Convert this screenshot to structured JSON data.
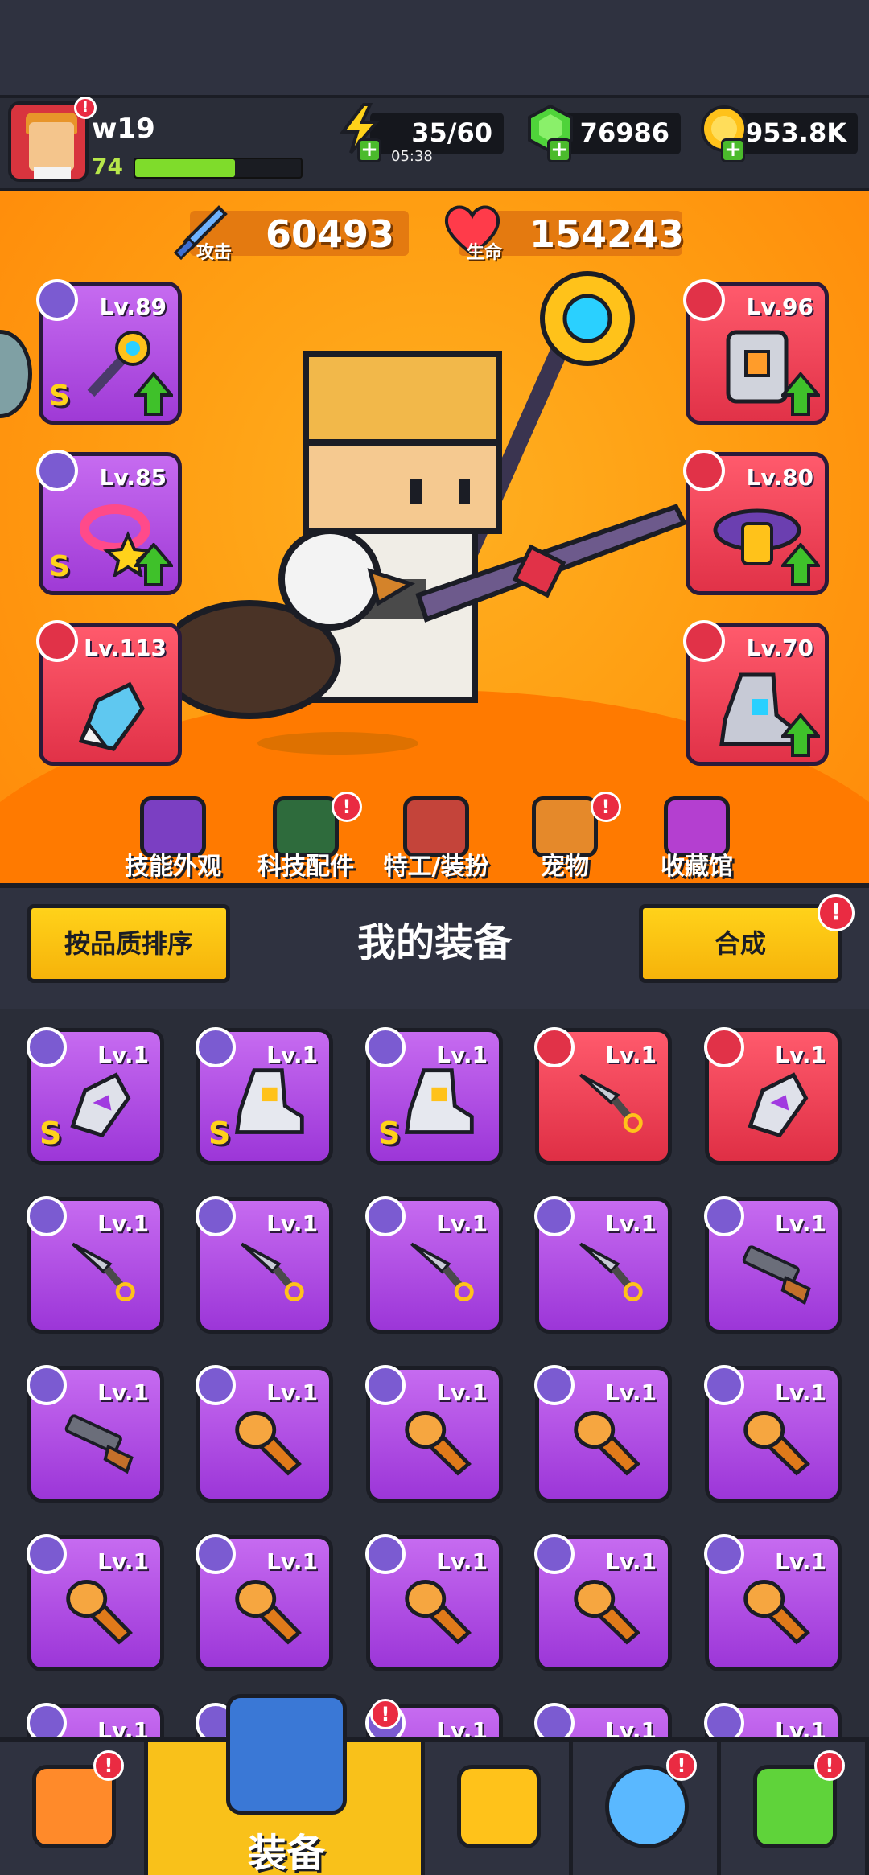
{
  "player": {
    "name": "w19",
    "level": "74",
    "xp_fraction": 0.6
  },
  "resources": {
    "energy": {
      "value": "35/60",
      "timer": "05:38"
    },
    "gems": {
      "value": "76986"
    },
    "gold": {
      "value": "953.8K"
    }
  },
  "stats": {
    "attack": {
      "label": "攻击",
      "value": "60493"
    },
    "hp": {
      "label": "生命",
      "value": "154243"
    }
  },
  "equipped": {
    "weapon": {
      "level": "Lv.89",
      "grade": "S",
      "upgradable": true,
      "icon": "staff-icon"
    },
    "armor": {
      "level": "Lv.96",
      "upgradable": true,
      "icon": "armor-icon"
    },
    "necklace": {
      "level": "Lv.85",
      "grade": "S",
      "upgradable": true,
      "icon": "ring-icon"
    },
    "belt": {
      "level": "Lv.80",
      "upgradable": true,
      "icon": "belt-icon"
    },
    "gloves": {
      "level": "Lv.113",
      "upgradable": false,
      "icon": "glove-icon"
    },
    "boots": {
      "level": "Lv.70",
      "upgradable": true,
      "icon": "boot-icon"
    }
  },
  "tabs": [
    {
      "label": "技能外观",
      "alert": false
    },
    {
      "label": "科技配件",
      "alert": true
    },
    {
      "label": "特工/装扮",
      "alert": false
    },
    {
      "label": "宠物",
      "alert": true
    },
    {
      "label": "收藏馆",
      "alert": false
    }
  ],
  "equipment_panel": {
    "sort_label": "按品质排序",
    "title": "我的装备",
    "merge_label": "合成",
    "badge": "!"
  },
  "inventory": [
    {
      "level": "Lv.1",
      "rarity": "purple",
      "grade": "S",
      "item": "glove-icon"
    },
    {
      "level": "Lv.1",
      "rarity": "purple",
      "grade": "S",
      "item": "boot-icon"
    },
    {
      "level": "Lv.1",
      "rarity": "purple",
      "grade": "S",
      "item": "boot-icon"
    },
    {
      "level": "Lv.1",
      "rarity": "red",
      "grade": "",
      "item": "kunai-icon"
    },
    {
      "level": "Lv.1",
      "rarity": "red",
      "grade": "",
      "item": "glove-icon"
    },
    {
      "level": "Lv.1",
      "rarity": "purple",
      "grade": "",
      "item": "kunai-icon"
    },
    {
      "level": "Lv.1",
      "rarity": "purple",
      "grade": "",
      "item": "kunai-icon"
    },
    {
      "level": "Lv.1",
      "rarity": "purple",
      "grade": "",
      "item": "kunai-icon"
    },
    {
      "level": "Lv.1",
      "rarity": "purple",
      "grade": "",
      "item": "kunai-icon"
    },
    {
      "level": "Lv.1",
      "rarity": "purple",
      "grade": "",
      "item": "shotgun-icon"
    },
    {
      "level": "Lv.1",
      "rarity": "purple",
      "grade": "",
      "item": "shotgun-icon"
    },
    {
      "level": "Lv.1",
      "rarity": "purple",
      "grade": "",
      "item": "rocket-icon"
    },
    {
      "level": "Lv.1",
      "rarity": "purple",
      "grade": "",
      "item": "rocket-icon"
    },
    {
      "level": "Lv.1",
      "rarity": "purple",
      "grade": "",
      "item": "rocket-icon"
    },
    {
      "level": "Lv.1",
      "rarity": "purple",
      "grade": "",
      "item": "rocket-icon"
    },
    {
      "level": "Lv.1",
      "rarity": "purple",
      "grade": "",
      "item": "rocket-icon"
    },
    {
      "level": "Lv.1",
      "rarity": "purple",
      "grade": "",
      "item": "rocket-icon"
    },
    {
      "level": "Lv.1",
      "rarity": "purple",
      "grade": "",
      "item": "rocket-icon"
    },
    {
      "level": "Lv.1",
      "rarity": "purple",
      "grade": "",
      "item": "rocket-icon"
    },
    {
      "level": "Lv.1",
      "rarity": "purple",
      "grade": "",
      "item": "rocket-icon"
    },
    {
      "level": "Lv.1",
      "rarity": "purple",
      "grade": "",
      "item": "rocket-icon"
    },
    {
      "level": "Lv.1",
      "rarity": "purple",
      "grade": "",
      "item": "rocket-icon"
    },
    {
      "level": "Lv.1",
      "rarity": "purple",
      "grade": "",
      "item": "rocket-icon"
    },
    {
      "level": "Lv.1",
      "rarity": "purple",
      "grade": "",
      "item": "rocket-icon"
    },
    {
      "level": "Lv.1",
      "rarity": "purple",
      "grade": "",
      "item": "rocket-icon"
    }
  ],
  "bottom_nav": [
    {
      "label": "",
      "icon": "shop-icon",
      "active": false,
      "alert": true
    },
    {
      "label": "装备",
      "icon": "equipment-icon",
      "active": true,
      "alert": true
    },
    {
      "label": "",
      "icon": "star-swords-icon",
      "active": false,
      "alert": false
    },
    {
      "label": "",
      "icon": "planet-icon",
      "active": false,
      "alert": true
    },
    {
      "label": "",
      "icon": "dna-icon",
      "active": false,
      "alert": true
    }
  ],
  "colors": {
    "accent": "#f9c11a",
    "purple": "#b44ee6",
    "red": "#ef3f56",
    "hero_bg": "#ff9e12",
    "upgrade": "#3fc12a"
  }
}
